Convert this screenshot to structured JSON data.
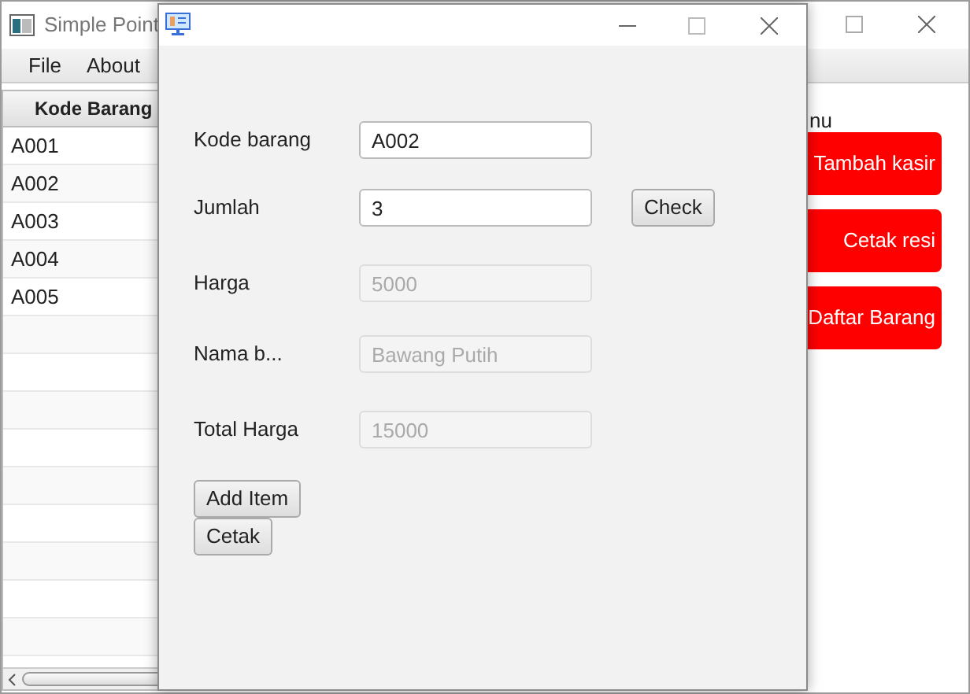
{
  "main_window": {
    "title": "Simple Point",
    "menu": [
      "File",
      "About"
    ],
    "table": {
      "columns": [
        "Kode Barang"
      ],
      "rows": [
        [
          "A001"
        ],
        [
          "A002"
        ],
        [
          "A003"
        ],
        [
          "A004"
        ],
        [
          "A005"
        ]
      ]
    },
    "side_panel": {
      "label": "nu",
      "buttons": [
        "Tambah kasir",
        "Cetak resi",
        "Daftar Barang"
      ]
    }
  },
  "dialog": {
    "fields": [
      {
        "label": "Kode barang",
        "value": "A002",
        "disabled": false
      },
      {
        "label": "Jumlah",
        "value": "3",
        "disabled": false
      },
      {
        "label": "Harga",
        "value": "5000",
        "disabled": true
      },
      {
        "label": "Nama b...",
        "value": "Bawang Putih",
        "disabled": true
      },
      {
        "label": "Total Harga",
        "value": "15000",
        "disabled": true
      }
    ],
    "check_button": "Check",
    "buttons": [
      "Add Item",
      "Cetak"
    ]
  }
}
